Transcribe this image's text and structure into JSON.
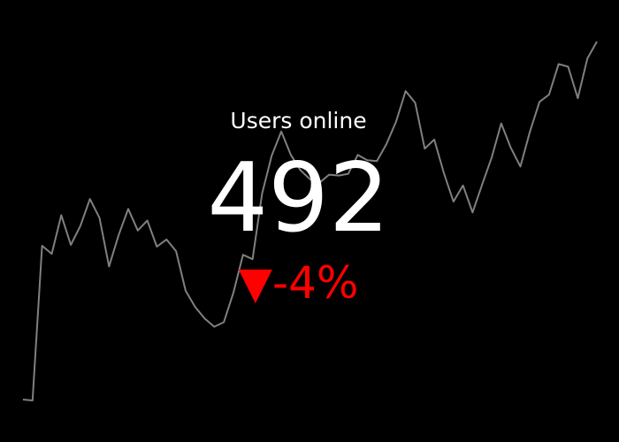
{
  "chart_data": {
    "type": "line",
    "title": "Users online",
    "value": "492",
    "delta": "-4%",
    "delta_symbol": "▼",
    "delta_color": "#ff0000",
    "text_color": "#ffffff",
    "background": "#000000",
    "line_color": "#808080",
    "grid": false,
    "x": [
      0,
      1,
      2,
      3,
      4,
      5,
      6,
      7,
      8,
      9,
      10,
      11,
      12,
      13,
      14,
      15,
      16,
      17,
      18,
      19,
      20,
      21,
      22,
      23,
      24,
      25,
      26,
      27,
      28,
      29,
      30,
      31,
      32,
      33,
      34,
      35,
      36,
      37,
      38,
      39,
      40,
      41,
      42,
      43,
      44,
      45,
      46,
      47,
      48,
      49,
      50,
      51,
      52,
      53,
      54,
      55,
      56,
      57,
      58,
      59,
      60
    ],
    "series": [
      {
        "values": [
          5,
          4,
          176,
          167,
          210,
          177,
          198,
          228,
          207,
          153,
          188,
          217,
          193,
          204,
          175,
          183,
          170,
          126,
          108,
          95,
          86,
          91,
          124,
          166,
          161,
          234,
          276,
          303,
          277,
          260,
          250,
          246,
          255,
          254,
          256,
          277,
          271,
          270,
          289,
          314,
          348,
          335,
          284,
          294,
          257,
          225,
          243,
          213,
          244,
          274,
          312,
          285,
          264,
          303,
          336,
          344,
          378,
          375,
          340,
          384,
          403
        ]
      }
    ]
  }
}
